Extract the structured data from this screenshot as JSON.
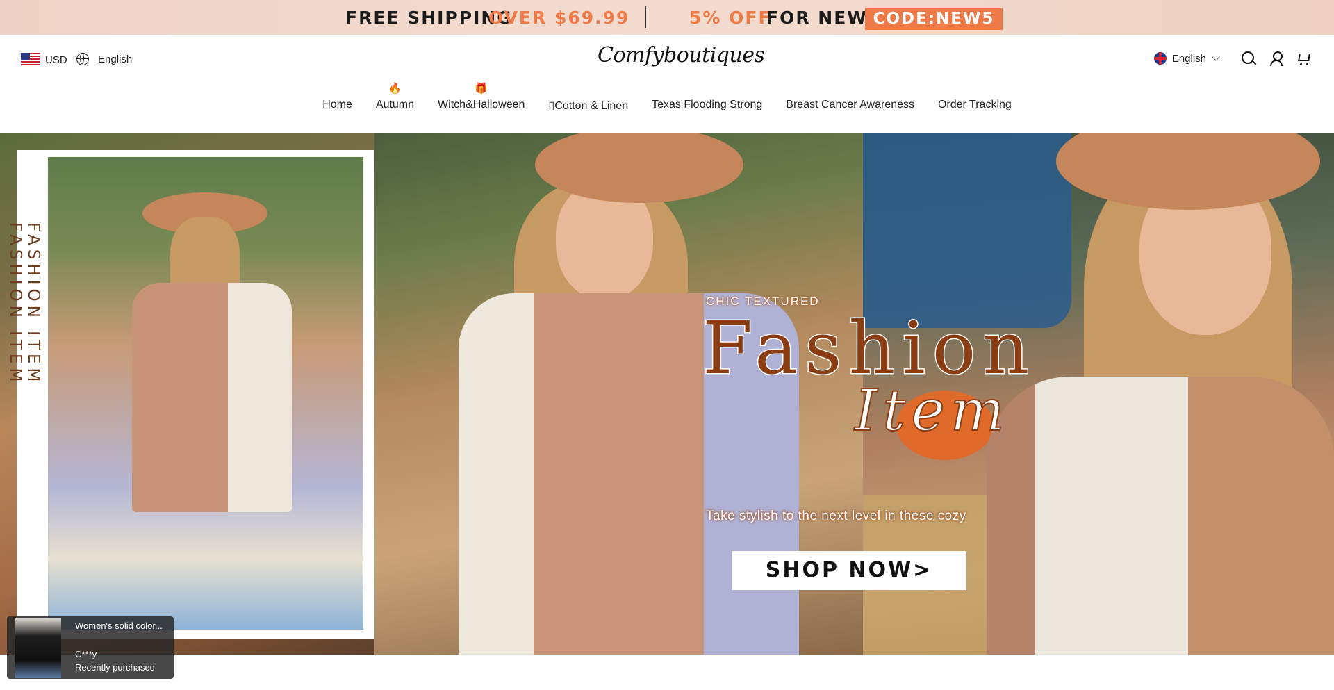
{
  "promo": {
    "free_shipping": "FREE SHIPPING",
    "over_amount": "OVER $69.99",
    "discount": "5% OFF",
    "for_new": "FOR NEW",
    "code": "CODE:NEW5",
    "accent_color": "#ee7a47"
  },
  "header": {
    "currency": "USD",
    "language_left": "English",
    "logo": "Comfyboutiques",
    "language_right": "English"
  },
  "nav": {
    "items": [
      {
        "label": "Home",
        "badge": ""
      },
      {
        "label": "Autumn",
        "badge": "🔥"
      },
      {
        "label": "Witch&Halloween",
        "badge": "🎁"
      },
      {
        "label": "Cotton & Linen",
        "badge": ""
      },
      {
        "label": "Texas Flooding Strong",
        "badge": ""
      },
      {
        "label": "Breast Cancer Awareness",
        "badge": ""
      },
      {
        "label": "Order Tracking",
        "badge": ""
      }
    ]
  },
  "hero": {
    "side_text_1": "FASHION ITEM",
    "side_text_2": "FASHION ITEM",
    "eyebrow": "CHIC TEXTURED",
    "headline": "Fashion",
    "headline_script": "Item",
    "tagline": "Take stylish to the next level in these cozy",
    "cta": "SHOP NOW>"
  },
  "toast": {
    "product": "Women's solid color...",
    "buyer": "C***y",
    "status": "Recently purchased"
  }
}
